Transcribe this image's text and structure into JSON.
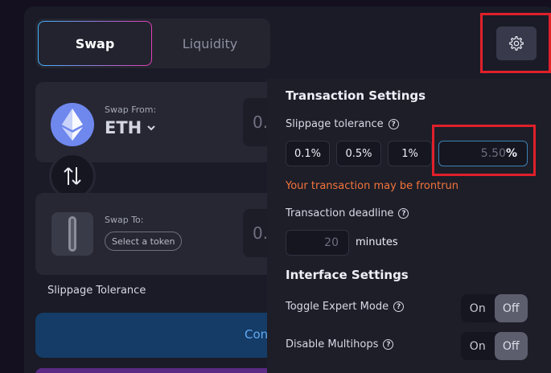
{
  "tabs": {
    "swap": "Swap",
    "liquidity": "Liquidity"
  },
  "swap_from": {
    "label": "Swap From:",
    "token": "ETH",
    "amount": "0."
  },
  "swap_to": {
    "label": "Swap To:",
    "select_token": "Select a token",
    "amount": "0."
  },
  "slippage_left": "Slippage Tolerance",
  "connect_button": "Con",
  "settings": {
    "transaction_title": "Transaction Settings",
    "slippage_label": "Slippage tolerance",
    "presets": [
      "0.1%",
      "0.5%",
      "1%"
    ],
    "custom_value": "5.50",
    "custom_unit": "%",
    "warning": "Your transaction may be frontrun",
    "deadline_label": "Transaction deadline",
    "deadline_value": "20",
    "deadline_unit": "minutes",
    "interface_title": "Interface Settings",
    "expert_mode_label": "Toggle Expert Mode",
    "multihop_label": "Disable Multihops",
    "toggle_on": "On",
    "toggle_off": "Off"
  },
  "info_glyph": "?",
  "colors": {
    "accent_blue": "#3d82b6",
    "warning": "#f4743b",
    "highlight": "#e0202a",
    "eth": "#6f88ee"
  }
}
